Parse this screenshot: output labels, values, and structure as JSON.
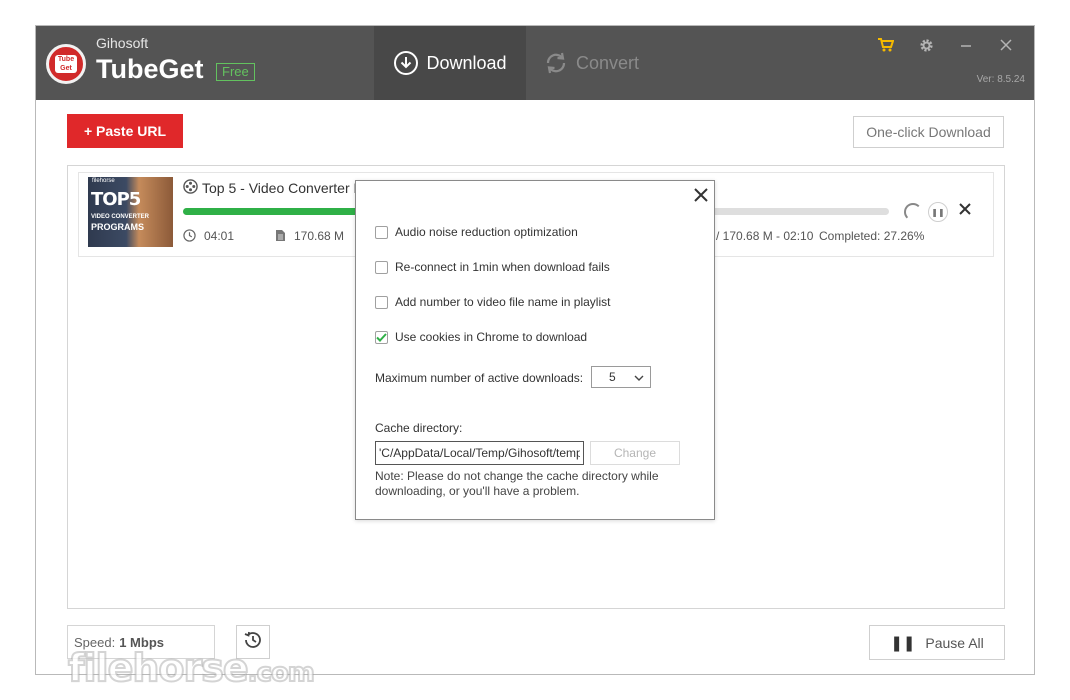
{
  "app": {
    "company": "Gihosoft",
    "name": "TubeGet",
    "edition_badge": "Free",
    "version": "Ver: 8.5.24",
    "logo_text_1": "Tube",
    "logo_text_2": "Get"
  },
  "tabs": [
    {
      "label": "Download",
      "icon": "download-circle-icon",
      "active": true
    },
    {
      "label": "Convert",
      "icon": "convert-icon",
      "active": false
    }
  ],
  "title_icons": [
    "cart-icon",
    "gear-icon",
    "minimize-icon",
    "close-icon"
  ],
  "toolbar": {
    "paste_url": "+ Paste URL",
    "one_click": "One-click Download"
  },
  "download_item": {
    "title": "Top 5 - Video Converter P",
    "duration": "04:01",
    "size": "170.68 M",
    "progress_text": "/ 170.68 M - 02:10",
    "completed": "Completed: 27.26%",
    "progress": 0.2726,
    "thumbnail": {
      "small": "filehorse",
      "big": "TOP5",
      "line1": "VIDEO CONVERTER",
      "line2": "PROGRAMS"
    }
  },
  "footer": {
    "speed_label": "Speed:",
    "speed_value": "1 Mbps",
    "pause_all": "Pause All"
  },
  "watermark": {
    "main": "filehorse",
    "suffix": ".com"
  },
  "dialog": {
    "options": [
      {
        "label": "Audio noise reduction optimization",
        "checked": false
      },
      {
        "label": "Re-connect in 1min when download fails",
        "checked": false
      },
      {
        "label": "Add number to video file name in playlist",
        "checked": false
      },
      {
        "label": "Use cookies in Chrome to download",
        "checked": true
      }
    ],
    "max_downloads_label": "Maximum number of active downloads:",
    "max_downloads_value": "5",
    "cache_label": "Cache directory:",
    "cache_path": "'C/AppData/Local/Temp/Gihosoft/temp",
    "change_label": "Change",
    "note": "Note: Please do not change the cache directory while downloading, or you'll have a problem."
  },
  "colors": {
    "titlebar": "#545454",
    "accent_red": "#e0282a",
    "progress_green": "#2fb047",
    "free_green": "#63c25f",
    "cart_yellow": "#f5b900"
  }
}
